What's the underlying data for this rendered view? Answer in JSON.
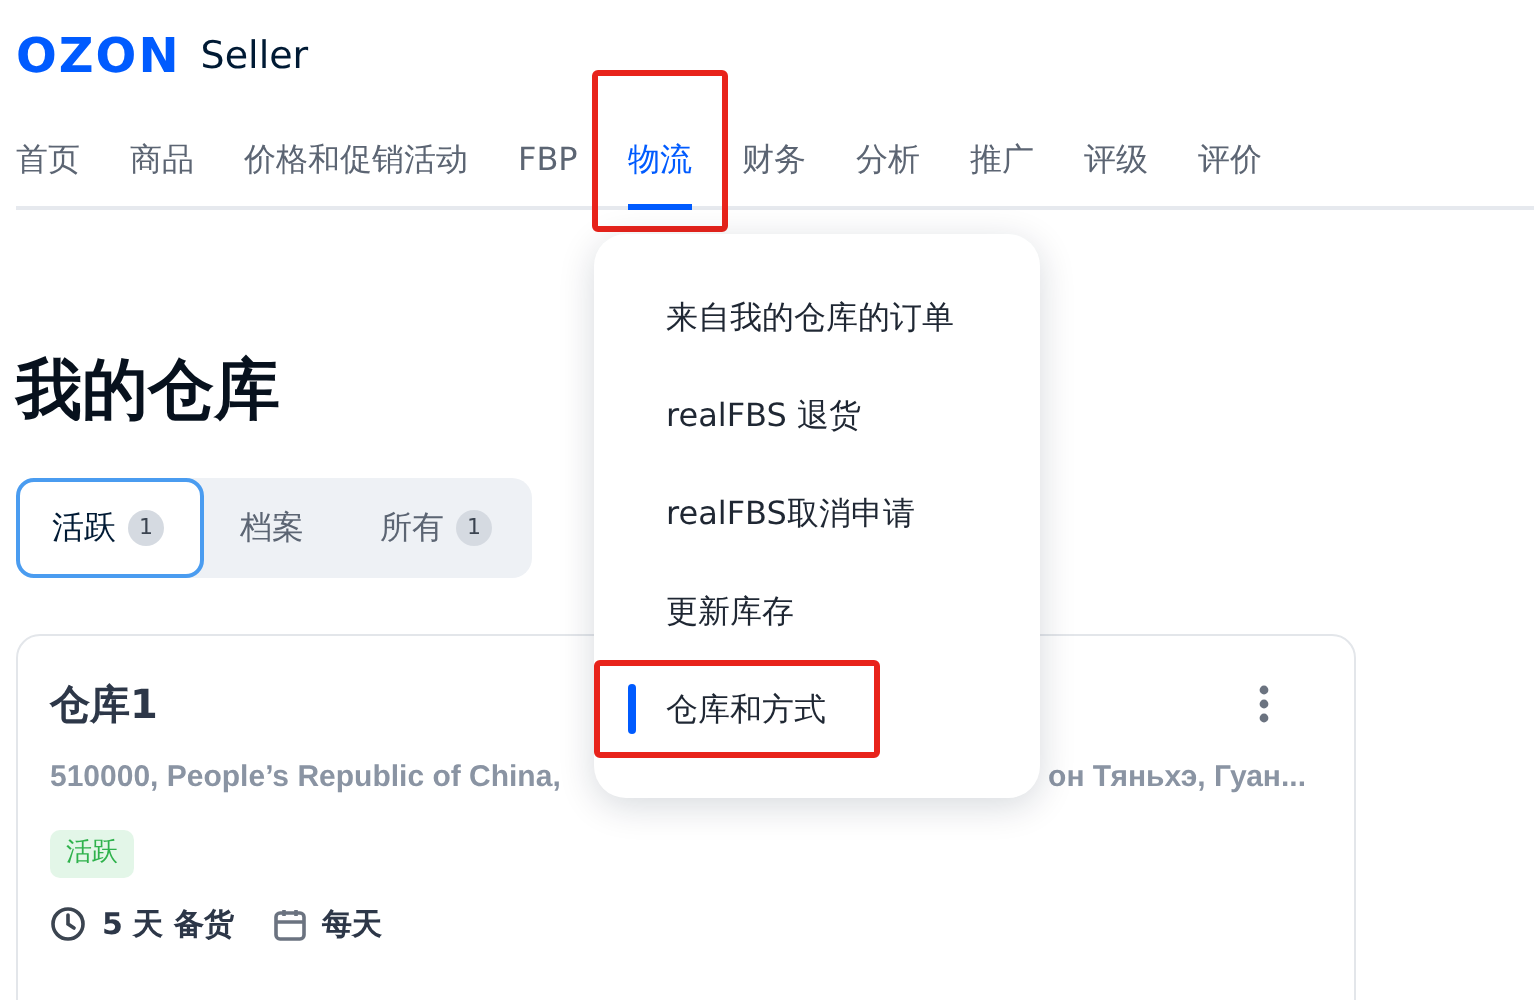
{
  "logo": {
    "brand": "OZON",
    "product": "Seller"
  },
  "nav": [
    {
      "label": "首页",
      "selected": false,
      "annotated": false
    },
    {
      "label": "商品",
      "selected": false,
      "annotated": false
    },
    {
      "label": "价格和促销活动",
      "selected": false,
      "annotated": false
    },
    {
      "label": "FBP",
      "selected": false,
      "annotated": false
    },
    {
      "label": "物流",
      "selected": true,
      "annotated": true
    },
    {
      "label": "财务",
      "selected": false,
      "annotated": false
    },
    {
      "label": "分析",
      "selected": false,
      "annotated": false
    },
    {
      "label": "推广",
      "selected": false,
      "annotated": false
    },
    {
      "label": "评级",
      "selected": false,
      "annotated": false
    },
    {
      "label": "评价",
      "selected": false,
      "annotated": false
    }
  ],
  "dropdown": [
    {
      "label": "来自我的仓库的订单",
      "selected": false,
      "annotated": false
    },
    {
      "label": "realFBS 退货",
      "selected": false,
      "annotated": false
    },
    {
      "label": "realFBS取消申请",
      "selected": false,
      "annotated": false
    },
    {
      "label": "更新库存",
      "selected": false,
      "annotated": false
    },
    {
      "label": "仓库和方式",
      "selected": true,
      "annotated": true
    }
  ],
  "page_title": "我的仓库",
  "tabs": [
    {
      "label": "活跃",
      "count": "1",
      "selected": true
    },
    {
      "label": "档案",
      "selected": false
    },
    {
      "label": "所有",
      "count": "1",
      "selected": false
    }
  ],
  "warehouse_card": {
    "name": "仓库1",
    "address_start": "510000, People’s Republic of China,",
    "address_end": "он Тяньхэ, Гуан...",
    "status": "活跃",
    "prep_time": "5 天 备货",
    "schedule": "每天"
  }
}
